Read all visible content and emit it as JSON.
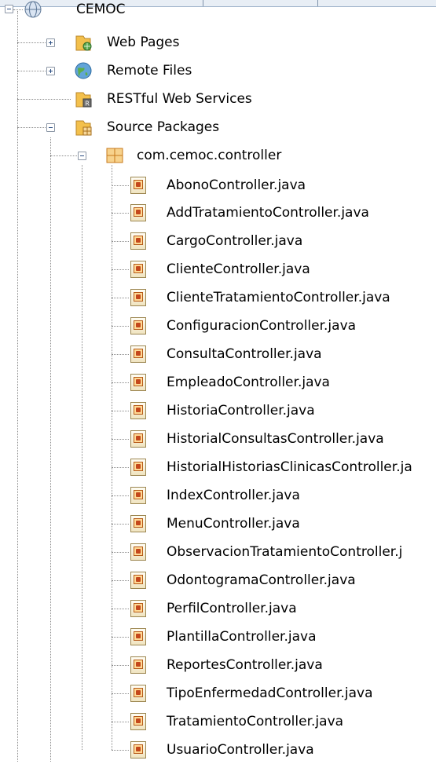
{
  "project": {
    "label": "CEMOC",
    "icon": "globe-project-icon"
  },
  "top_nodes": [
    {
      "label": "Web Pages",
      "icon": "web-pages-folder-icon",
      "expanded": false
    },
    {
      "label": "Remote Files",
      "icon": "remote-files-globe-icon",
      "expanded": false
    },
    {
      "label": "RESTful Web Services",
      "icon": "restful-folder-icon",
      "expanded": null
    },
    {
      "label": "Source Packages",
      "icon": "source-packages-folder-icon",
      "expanded": true
    }
  ],
  "package": {
    "label": "com.cemoc.controller",
    "icon": "package-icon",
    "expanded": true
  },
  "files": [
    "AbonoController.java",
    "AddTratamientoController.java",
    "CargoController.java",
    "ClienteController.java",
    "ClienteTratamientoController.java",
    "ConfiguracionController.java",
    "ConsultaController.java",
    "EmpleadoController.java",
    "HistoriaController.java",
    "HistorialConsultasController.java",
    "HistorialHistoriasClinicasController.ja",
    "IndexController.java",
    "MenuController.java",
    "ObservacionTratamientoController.j",
    "OdontogramaController.java",
    "PerfilController.java",
    "PlantillaController.java",
    "ReportesController.java",
    "TipoEnfermedadController.java",
    "TratamientoController.java",
    "UsuarioController.java"
  ],
  "colors": {
    "tree_line": "#8a8a8a",
    "expander_border": "#8c97a6",
    "expander_sign": "#2a4d83",
    "background": "#ffffff"
  }
}
